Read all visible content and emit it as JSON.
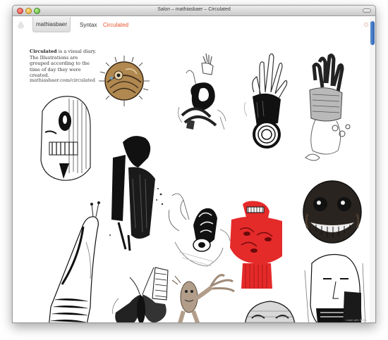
{
  "window": {
    "title": "Salon – mathiasbaer – Circulated"
  },
  "nav": {
    "home_tab": "mathiasbaer",
    "links": [
      "Syntax",
      "Circulated"
    ],
    "accent_color": "#e8502b"
  },
  "intro": {
    "title": "Circulated",
    "body": " is a visual diary. The Illustrations are grouped according to the time of day they were created.",
    "link": "mathiasbaer.com/circulated"
  },
  "footer": {
    "credit": "made with Salon"
  },
  "icons": [
    "drop-icon",
    "gear-icon"
  ],
  "illustrations": [
    "sepia-sun-drawing",
    "hand-knot-drawing",
    "raised-hand-drawing",
    "tentacle-hand-drawing",
    "skull-face-drawing",
    "black-ink-figure-drawing",
    "scribble-hand-drawing",
    "red-figure-drawing",
    "grinning-face-drawing",
    "snail-figure-drawing",
    "moth-drawing",
    "dancing-figure-drawing",
    "portrait-sketch-drawing",
    "bald-head-drawing"
  ]
}
